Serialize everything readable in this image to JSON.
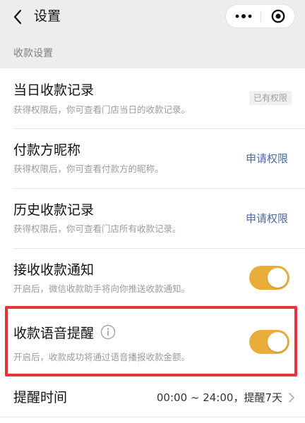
{
  "nav": {
    "title": "设置"
  },
  "section": {
    "title": "收款设置"
  },
  "rows": [
    {
      "title": "当日收款记录",
      "desc": "获得权限后，你可查看门店当日的收款记录。",
      "status": "已有权限"
    },
    {
      "title": "付款方昵称",
      "desc": "获得权限后，你可查看付款方的昵称。",
      "action": "申请权限"
    },
    {
      "title": "历史收款记录",
      "desc": "获得权限后，你可查看门店所有收款记录。",
      "action": "申请权限"
    },
    {
      "title": "接收收款通知",
      "desc": "开启后，微信收款助手将向你推送收款通知。",
      "toggle_on": true
    },
    {
      "title": "收款语音提醒",
      "desc": "开启后，收款成功将通过语音播报收款金额。",
      "toggle_on": true
    },
    {
      "title": "提醒时间",
      "value": "00:00 ~ 24:00，提醒7天"
    }
  ],
  "icons": {
    "back": "back-arrow-icon",
    "more": "more-dots-icon",
    "close": "target-close-icon",
    "info": "info-icon",
    "chevron": "chevron-right-icon"
  },
  "colors": {
    "toggle_on": "#e9ae3a",
    "link": "#4b6ba3",
    "highlight": "#e63535",
    "background": "#ededed"
  }
}
